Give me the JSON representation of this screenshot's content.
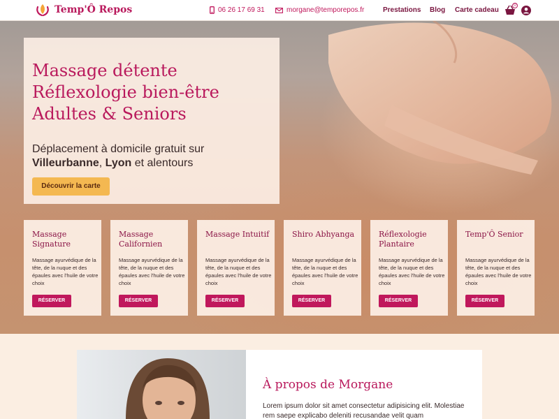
{
  "header": {
    "brand": "Temp'Ô Repos",
    "phone": "06 26 17 69 31",
    "email": "morgane@temporepos.fr",
    "nav": [
      "Prestations",
      "Blog",
      "Carte cadeau"
    ],
    "cart_count": "0"
  },
  "hero": {
    "title_lines": [
      "Massage détente",
      "Réflexologie bien-être",
      "Adultes & Seniors"
    ],
    "subtitle_start": "Déplacement à domicile gratuit sur",
    "city1": "Villeurbanne",
    "sep": ",",
    "city2": "Lyon",
    "subtitle_end": "et alentours",
    "cta": "Découvrir la carte"
  },
  "cards": [
    {
      "title": "Massage Signature",
      "text": "Massage ayurvédique de la tête, de la nuque et des épaules avec l'huile de votre choix",
      "button": "RÉSERVER"
    },
    {
      "title": "Massage Californien",
      "text": "Massage ayurvédique de la tête, de la nuque et des épaules avec l'huile de votre choix",
      "button": "RÉSERVER"
    },
    {
      "title": "Massage Intuitif",
      "text": "Massage ayurvédique de la tête, de la nuque et des épaules avec l'huile de votre choix",
      "button": "RÉSERVER"
    },
    {
      "title": "Shiro Abhyanga",
      "text": "Massage ayurvédique de la tête, de la nuque et des épaules avec l'huile de votre choix",
      "button": "RÉSERVER"
    },
    {
      "title": "Réflexologie Plantaire",
      "text": "Massage ayurvédique de la tête, de la nuque et des épaules avec l'huile de votre choix",
      "button": "RÉSERVER"
    },
    {
      "title": "Temp'Ô Senior",
      "text": "Massage ayurvédique de la tête, de la nuque et des épaules avec l'huile de votre choix",
      "button": "RÉSERVER"
    }
  ],
  "about": {
    "title": "À propos de Morgane",
    "text": "Lorem ipsum dolor sit amet consectetur adipisicing elit. Molestiae rem saepe explicabo deleniti recusandae velit quam"
  },
  "colors": {
    "brand": "#b9195c",
    "cta": "#f4b851",
    "button": "#c0185c",
    "page_bg": "#fbeee2"
  },
  "icons": [
    "lotus-logo-icon",
    "phone-icon",
    "mail-icon",
    "basket-icon",
    "user-icon"
  ]
}
